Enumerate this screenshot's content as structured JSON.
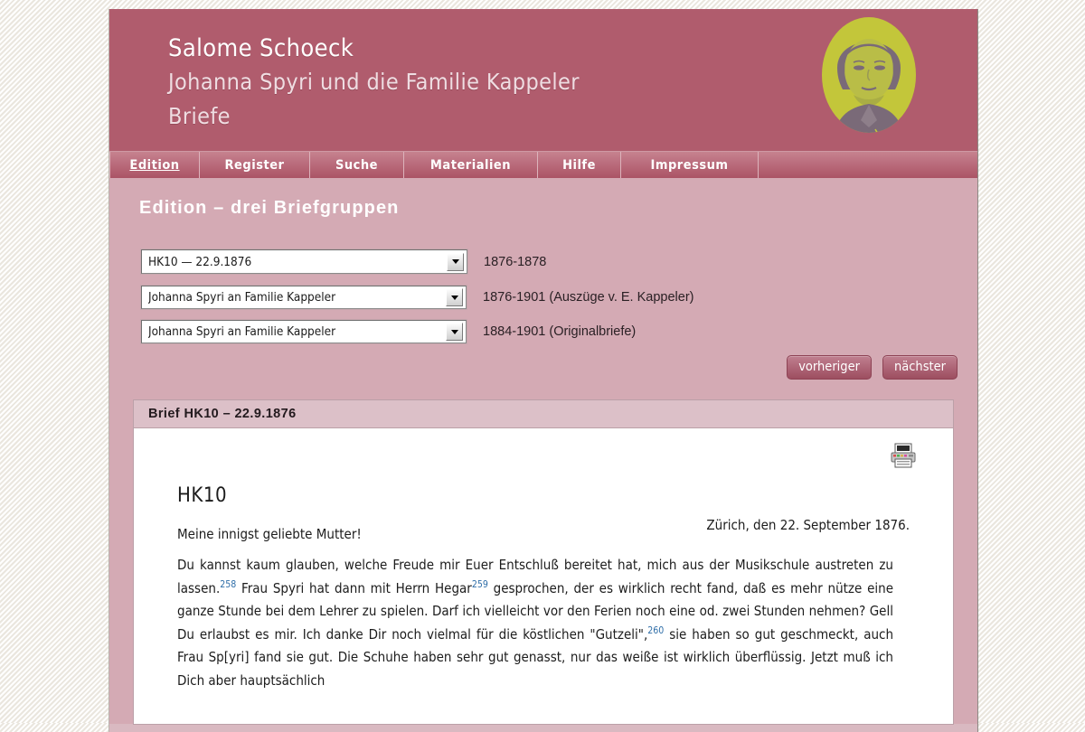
{
  "banner": {
    "line1": "Salome Schoeck",
    "line2": "Johanna Spyri und die Familie Kappeler",
    "line3": "Briefe",
    "portrait_alt": "portrait-salome-schoeck",
    "bg_color": "#b05c6d",
    "portrait_highlight": "#c3c63a",
    "portrait_shadow": "#7a6a78"
  },
  "nav": {
    "items": [
      {
        "label": "Edition",
        "active": true
      },
      {
        "label": "Register",
        "active": false
      },
      {
        "label": "Suche",
        "active": false
      },
      {
        "label": "Materialien",
        "active": false
      },
      {
        "label": "Hilfe",
        "active": false
      },
      {
        "label": "Impressum",
        "active": false
      }
    ]
  },
  "page": {
    "title": "Edition – drei Briefgruppen",
    "accent_color": "#b05c6d",
    "content_bg": "#d4aab4"
  },
  "selectors": [
    {
      "value": "HK10 — 22.9.1876",
      "note": "1876-1878"
    },
    {
      "value": "Johanna Spyri an Familie Kappeler",
      "note": "1876-1901 (Auszüge v. E. Kappeler)"
    },
    {
      "value": "Johanna Spyri an Familie Kappeler",
      "note": "1884-1901 (Originalbriefe)"
    }
  ],
  "pager": {
    "prev_label": "vorheriger",
    "next_label": "nächster"
  },
  "letter": {
    "panel_title": "Brief HK10 – 22.9.1876",
    "print_icon": "printer-icon",
    "id": "HK10",
    "place_date": "Zürich, den 22. September 1876.",
    "salutation": "Meine innigst geliebte Mutter!",
    "paragraph_part1": "Du kannst kaum glauben, welche Freude mir Euer Entschluß bereitet hat, mich aus der Musikschule austreten zu lassen.",
    "footnote1": "258",
    "paragraph_part2": " Frau Spyri hat dann mit Herrn Hegar",
    "footnote2": "259",
    "paragraph_part3": " gesprochen, der es wirklich recht fand, daß es mehr nütze eine ganze Stunde bei dem Lehrer zu spielen. Darf ich vielleicht vor den Ferien noch eine od. zwei Stunden nehmen? Gell Du erlaubst es mir. Ich danke Dir noch vielmal für die köstlichen \"Gutzeli\",",
    "footnote3": "260",
    "paragraph_part4": " sie haben so gut geschmeckt, auch Frau Sp[yri] fand sie gut. Die Schuhe haben sehr gut genasst, nur das weiße ist wirklich überflüssig. Jetzt muß ich Dich aber hauptsächlich",
    "footnote_color": "#2f6ea8"
  }
}
